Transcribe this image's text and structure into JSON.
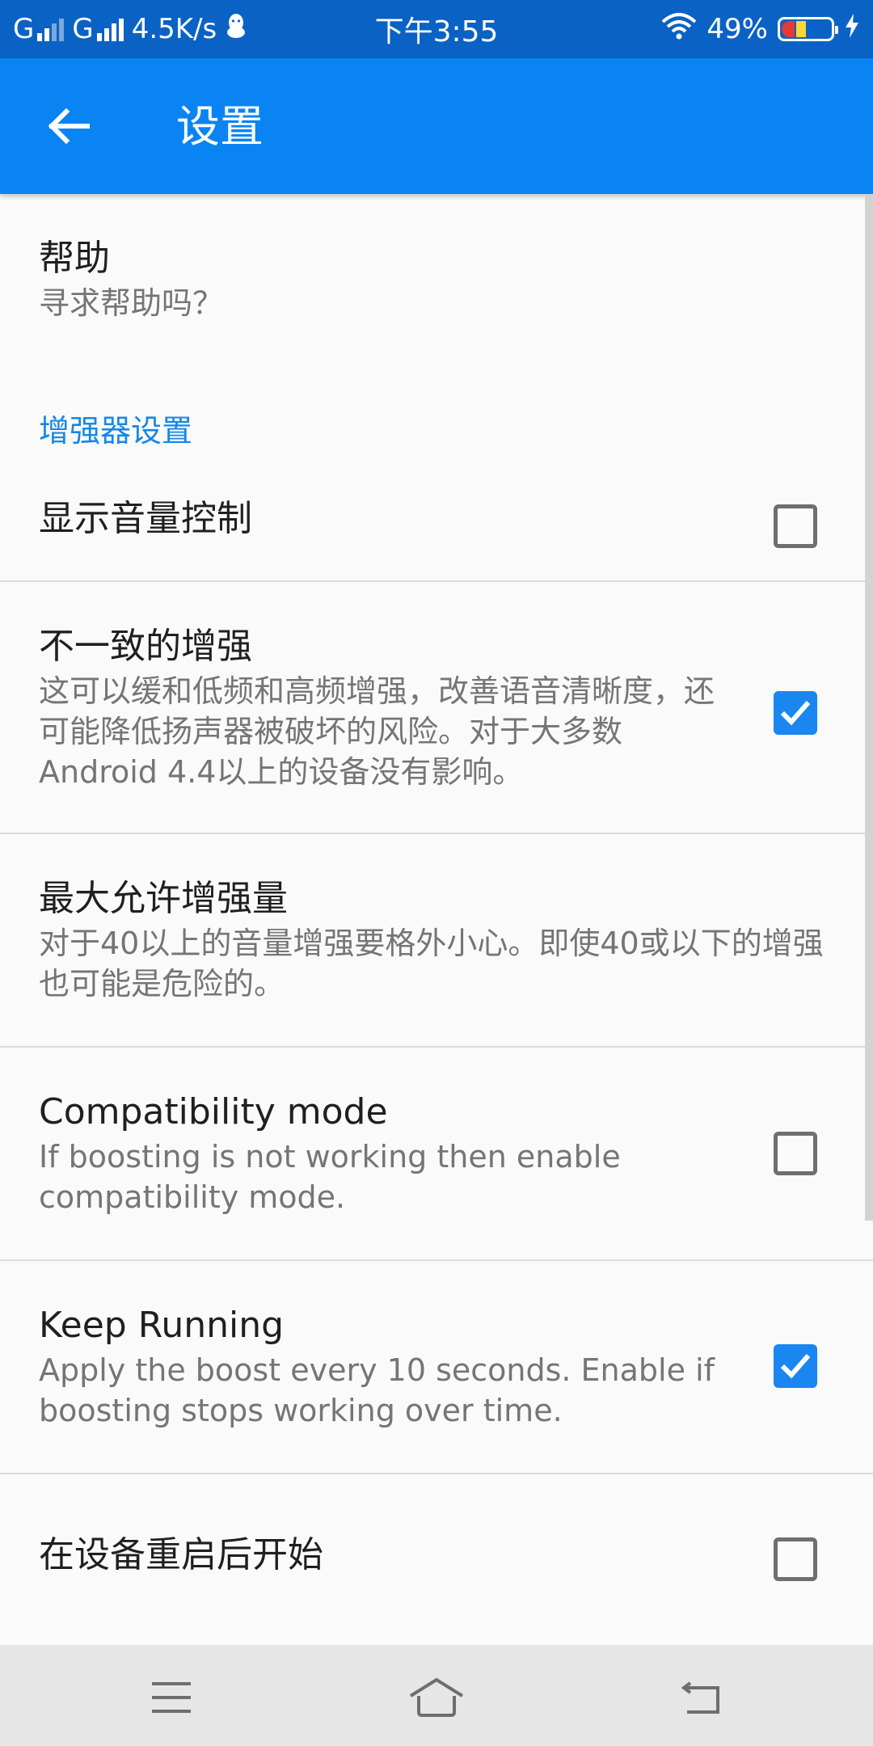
{
  "status_bar": {
    "sim1_label": "G",
    "sim2_label": "G",
    "speed": "4.5K/s",
    "time": "下午3:55",
    "battery": "49%",
    "icons": [
      "signal-icon",
      "qq-penguin-icon",
      "wifi-icon",
      "battery-icon",
      "charging-icon"
    ]
  },
  "app_bar": {
    "title": "设置",
    "back_icon": "arrow-left-icon"
  },
  "help": {
    "title": "帮助",
    "summary": "寻求帮助吗？"
  },
  "section": {
    "title": "增强器设置"
  },
  "settings": [
    {
      "title": "显示音量控制",
      "summary": "",
      "checked": false
    },
    {
      "title": "不一致的增强",
      "summary": "这可以缓和低频和高频增强，改善语音清晰度，还可能降低扬声器被破坏的风险。对于大多数Android 4.4以上的设备没有影响。",
      "checked": true
    },
    {
      "title": "最大允许增强量",
      "summary": "对于40以上的音量增强要格外小心。即使40或以下的增强也可能是危险的。"
    },
    {
      "title": "Compatibility mode",
      "summary": "If boosting is not working then enable compatibility mode.",
      "checked": false
    },
    {
      "title": "Keep Running",
      "summary": "Apply the boost every 10 seconds. Enable if boosting stops working over time.",
      "checked": true
    },
    {
      "title": "在设备重启后开始",
      "summary": "",
      "checked": false
    }
  ],
  "nav_bar": {
    "icons": [
      "menu-icon",
      "home-icon",
      "back-icon"
    ]
  },
  "colors": {
    "status_bar": "#0a62c4",
    "app_bar": "#0b84f3",
    "accent": "#1588e6",
    "checkbox_checked": "#1a86f0"
  }
}
